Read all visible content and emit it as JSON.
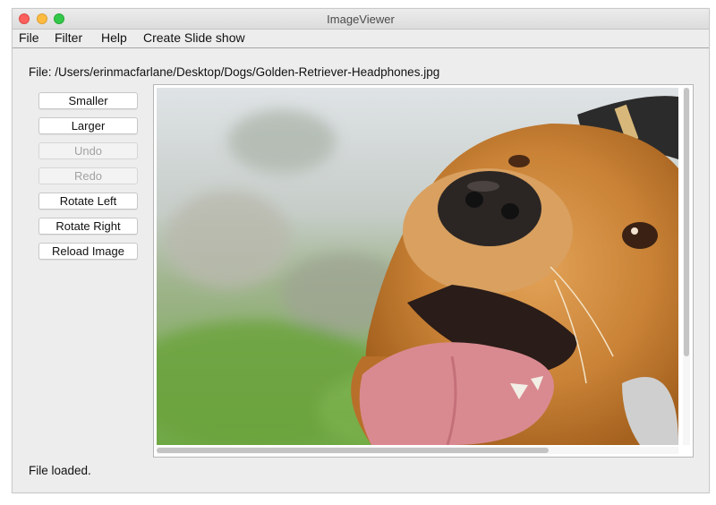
{
  "window": {
    "title": "ImageViewer"
  },
  "menu": {
    "items": [
      "File",
      "Filter",
      "Help",
      "Create Slide show"
    ]
  },
  "file_path": "File: /Users/erinmacfarlane/Desktop/Dogs/Golden-Retriever-Headphones.jpg",
  "buttons": [
    {
      "label": "Smaller",
      "enabled": true
    },
    {
      "label": "Larger",
      "enabled": true
    },
    {
      "label": "Undo",
      "enabled": false
    },
    {
      "label": "Redo",
      "enabled": false
    },
    {
      "label": "Rotate Left",
      "enabled": true
    },
    {
      "label": "Rotate Right",
      "enabled": true
    },
    {
      "label": "Reload Image",
      "enabled": true
    }
  ],
  "image": {
    "icon": "photo-golden-retriever"
  },
  "status": "File loaded.",
  "colors": {
    "close": "#fc605c",
    "minimize": "#fdbc40",
    "maximize": "#34c84a"
  }
}
